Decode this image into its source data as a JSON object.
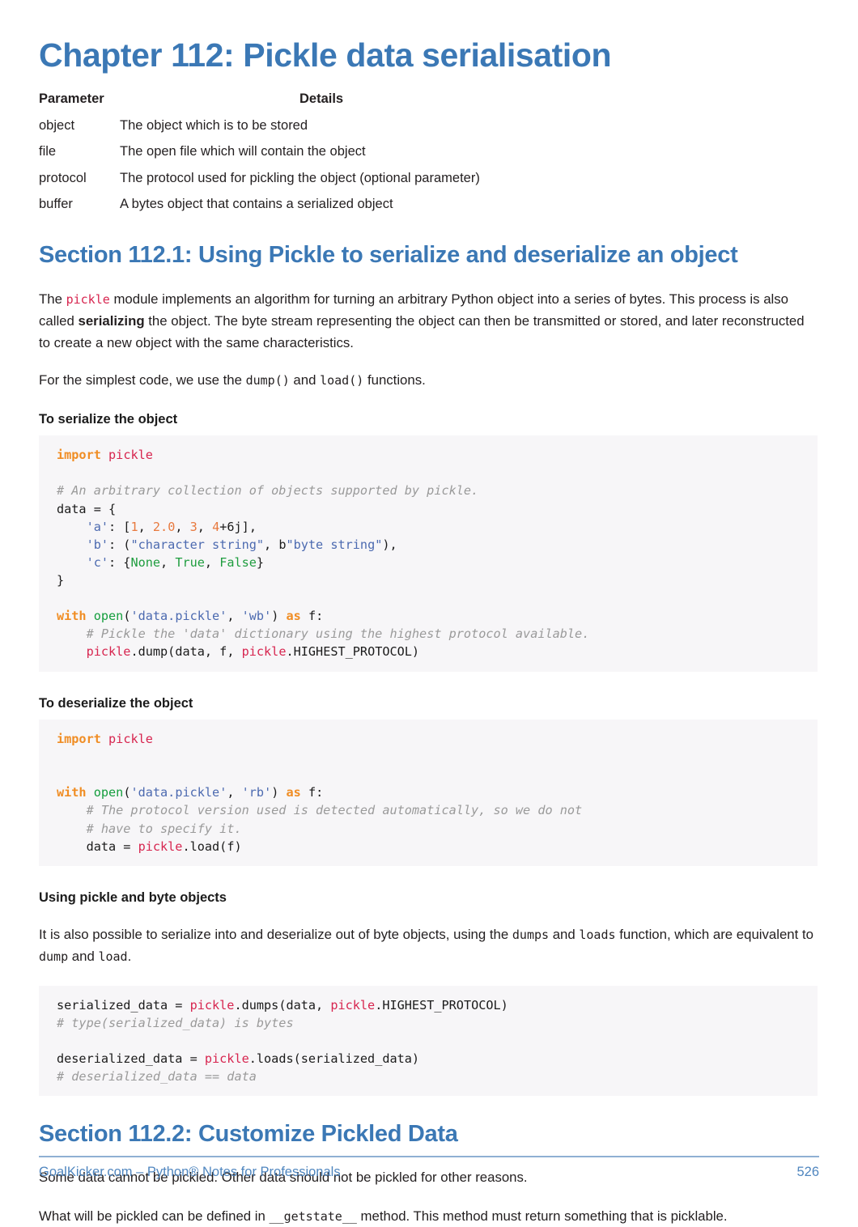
{
  "chapter": {
    "title": "Chapter 112: Pickle data serialisation"
  },
  "param_table": {
    "headers": [
      "Parameter",
      "Details"
    ],
    "rows": [
      {
        "parameter": "object",
        "details": "The object which is to be stored"
      },
      {
        "parameter": "file",
        "details": "The open file which will contain the object"
      },
      {
        "parameter": "protocol",
        "details": "The protocol used for pickling the object (optional parameter)"
      },
      {
        "parameter": "buffer",
        "details": "A bytes object that contains a serialized object"
      }
    ]
  },
  "section_1": {
    "title": "Section 112.1: Using Pickle to serialize and deserialize an object",
    "para_1": {
      "a": "The ",
      "code_1": "pickle",
      "b": " module implements an algorithm for turning an arbitrary Python object into a series of bytes. This process is also called ",
      "strong": "serializing",
      "c": " the object. The byte stream representing the object can then be transmitted or stored, and later reconstructed to create a new object with the same characteristics."
    },
    "para_2": {
      "a": "For the simplest code, we use the ",
      "code_1": "dump()",
      "b": " and ",
      "code_2": "load()",
      "c": " functions."
    },
    "serialize_heading": "To serialize the object",
    "serialize_code": [
      [
        {
          "t": "import",
          "c": "k"
        },
        {
          "t": " ",
          "c": "n"
        },
        {
          "t": "pickle",
          "c": "nn"
        }
      ],
      [
        {
          "t": "",
          "c": "n"
        }
      ],
      [
        {
          "t": "# An arbitrary collection of objects supported by pickle.",
          "c": "c"
        }
      ],
      [
        {
          "t": "data = {",
          "c": "n"
        }
      ],
      [
        {
          "t": "    ",
          "c": "n"
        },
        {
          "t": "'a'",
          "c": "s"
        },
        {
          "t": ": [",
          "c": "n"
        },
        {
          "t": "1",
          "c": "m"
        },
        {
          "t": ", ",
          "c": "n"
        },
        {
          "t": "2.0",
          "c": "m"
        },
        {
          "t": ", ",
          "c": "n"
        },
        {
          "t": "3",
          "c": "m"
        },
        {
          "t": ", ",
          "c": "n"
        },
        {
          "t": "4",
          "c": "m"
        },
        {
          "t": "+6j],",
          "c": "n"
        }
      ],
      [
        {
          "t": "    ",
          "c": "n"
        },
        {
          "t": "'b'",
          "c": "s"
        },
        {
          "t": ": (",
          "c": "n"
        },
        {
          "t": "\"character string\"",
          "c": "s"
        },
        {
          "t": ", b",
          "c": "n"
        },
        {
          "t": "\"byte string\"",
          "c": "s"
        },
        {
          "t": "),",
          "c": "n"
        }
      ],
      [
        {
          "t": "    ",
          "c": "n"
        },
        {
          "t": "'c'",
          "c": "s"
        },
        {
          "t": ": {",
          "c": "n"
        },
        {
          "t": "None",
          "c": "kc"
        },
        {
          "t": ", ",
          "c": "n"
        },
        {
          "t": "True",
          "c": "kc"
        },
        {
          "t": ", ",
          "c": "n"
        },
        {
          "t": "False",
          "c": "kc"
        },
        {
          "t": "}",
          "c": "n"
        }
      ],
      [
        {
          "t": "}",
          "c": "n"
        }
      ],
      [
        {
          "t": "",
          "c": "n"
        }
      ],
      [
        {
          "t": "with",
          "c": "k"
        },
        {
          "t": " ",
          "c": "n"
        },
        {
          "t": "open",
          "c": "bi"
        },
        {
          "t": "(",
          "c": "n"
        },
        {
          "t": "'data.pickle'",
          "c": "s"
        },
        {
          "t": ", ",
          "c": "n"
        },
        {
          "t": "'wb'",
          "c": "s"
        },
        {
          "t": ") ",
          "c": "n"
        },
        {
          "t": "as",
          "c": "k"
        },
        {
          "t": " f:",
          "c": "n"
        }
      ],
      [
        {
          "t": "    # Pickle the 'data' dictionary using the highest protocol available.",
          "c": "c"
        }
      ],
      [
        {
          "t": "    ",
          "c": "n"
        },
        {
          "t": "pickle",
          "c": "nn"
        },
        {
          "t": ".dump(data, f, ",
          "c": "n"
        },
        {
          "t": "pickle",
          "c": "nn"
        },
        {
          "t": ".HIGHEST_PROTOCOL)",
          "c": "n"
        }
      ]
    ],
    "deserialize_heading": "To deserialize the object",
    "deserialize_code": [
      [
        {
          "t": "import",
          "c": "k"
        },
        {
          "t": " ",
          "c": "n"
        },
        {
          "t": "pickle",
          "c": "nn"
        }
      ],
      [
        {
          "t": "",
          "c": "n"
        }
      ],
      [
        {
          "t": "",
          "c": "n"
        }
      ],
      [
        {
          "t": "with",
          "c": "k"
        },
        {
          "t": " ",
          "c": "n"
        },
        {
          "t": "open",
          "c": "bi"
        },
        {
          "t": "(",
          "c": "n"
        },
        {
          "t": "'data.pickle'",
          "c": "s"
        },
        {
          "t": ", ",
          "c": "n"
        },
        {
          "t": "'rb'",
          "c": "s"
        },
        {
          "t": ") ",
          "c": "n"
        },
        {
          "t": "as",
          "c": "k"
        },
        {
          "t": " f:",
          "c": "n"
        }
      ],
      [
        {
          "t": "    # The protocol version used is detected automatically, so we do not",
          "c": "c"
        }
      ],
      [
        {
          "t": "    # have to specify it.",
          "c": "c"
        }
      ],
      [
        {
          "t": "    data = ",
          "c": "n"
        },
        {
          "t": "pickle",
          "c": "nn"
        },
        {
          "t": ".load(f)",
          "c": "n"
        }
      ]
    ],
    "bytes_heading": "Using pickle and byte objects",
    "bytes_para": {
      "a": "It is also possible to serialize into and deserialize out of byte objects, using the ",
      "code_1": "dumps",
      "b": " and ",
      "code_2": "loads",
      "c": " function, which are equivalent to ",
      "code_3": "dump",
      "d": " and ",
      "code_4": "load",
      "e": "."
    },
    "bytes_code": [
      [
        {
          "t": "serialized_data = ",
          "c": "n"
        },
        {
          "t": "pickle",
          "c": "nn"
        },
        {
          "t": ".dumps(data, ",
          "c": "n"
        },
        {
          "t": "pickle",
          "c": "nn"
        },
        {
          "t": ".HIGHEST_PROTOCOL)",
          "c": "n"
        }
      ],
      [
        {
          "t": "# type(serialized_data) is bytes",
          "c": "c"
        }
      ],
      [
        {
          "t": "",
          "c": "n"
        }
      ],
      [
        {
          "t": "deserialized_data = ",
          "c": "n"
        },
        {
          "t": "pickle",
          "c": "nn"
        },
        {
          "t": ".loads(serialized_data)",
          "c": "n"
        }
      ],
      [
        {
          "t": "# deserialized_data == data",
          "c": "c"
        }
      ]
    ]
  },
  "section_2": {
    "title": "Section 112.2: Customize Pickled Data",
    "para_1": "Some data cannot be pickled. Other data should not be pickled for other reasons.",
    "para_2": {
      "a": "What will be pickled can be defined in ",
      "code_1": "__getstate__",
      "b": " method. This method must return something that is picklable."
    }
  },
  "footer": {
    "left": "GoalKicker.com – Python® Notes for Professionals",
    "page": "526"
  },
  "colors": {
    "heading_blue": "#3b78b5",
    "footer_blue": "#4f86bf",
    "inline_code_red": "#d7254f",
    "code_bg": "#f7f6f8",
    "keyword_orange": "#f08d24",
    "string_blue": "#4c6ab0",
    "number_orange": "#e8793e",
    "constant_green": "#1f9d3f",
    "comment_gray": "#9a9a9a"
  }
}
